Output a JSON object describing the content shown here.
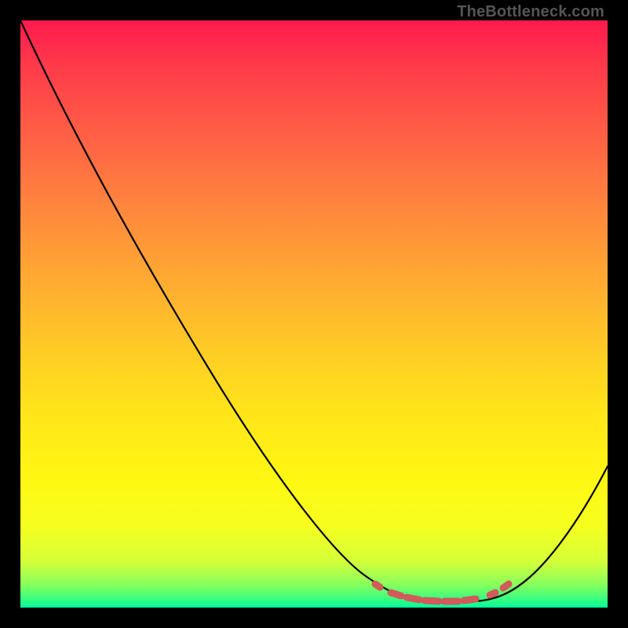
{
  "credit": "TheBottleneck.com",
  "chart_data": {
    "type": "line",
    "title": "",
    "xlabel": "",
    "ylabel": "",
    "xlim": [
      0,
      100
    ],
    "ylim": [
      0,
      100
    ],
    "series": [
      {
        "name": "curve",
        "x": [
          0,
          5,
          10,
          15,
          20,
          25,
          30,
          35,
          40,
          45,
          50,
          55,
          60,
          62,
          65,
          68,
          70,
          73,
          76,
          79,
          82,
          85,
          88,
          91,
          94,
          97,
          100
        ],
        "values": [
          100,
          93,
          86,
          79,
          72,
          64,
          56,
          48,
          40,
          32,
          24,
          16,
          9,
          6,
          3,
          1.5,
          0.8,
          0.4,
          0.3,
          0.3,
          0.4,
          0.9,
          2.5,
          6,
          11,
          17,
          24
        ]
      }
    ],
    "highlight_segment": {
      "x_start": 60,
      "x_end": 82,
      "note": "near-minimum flat region marked with salmon dashes"
    },
    "background_gradient": {
      "top": "#ff1a4d",
      "bottom": "#00ffa0",
      "description": "red → orange → yellow → green vertical gradient"
    }
  }
}
